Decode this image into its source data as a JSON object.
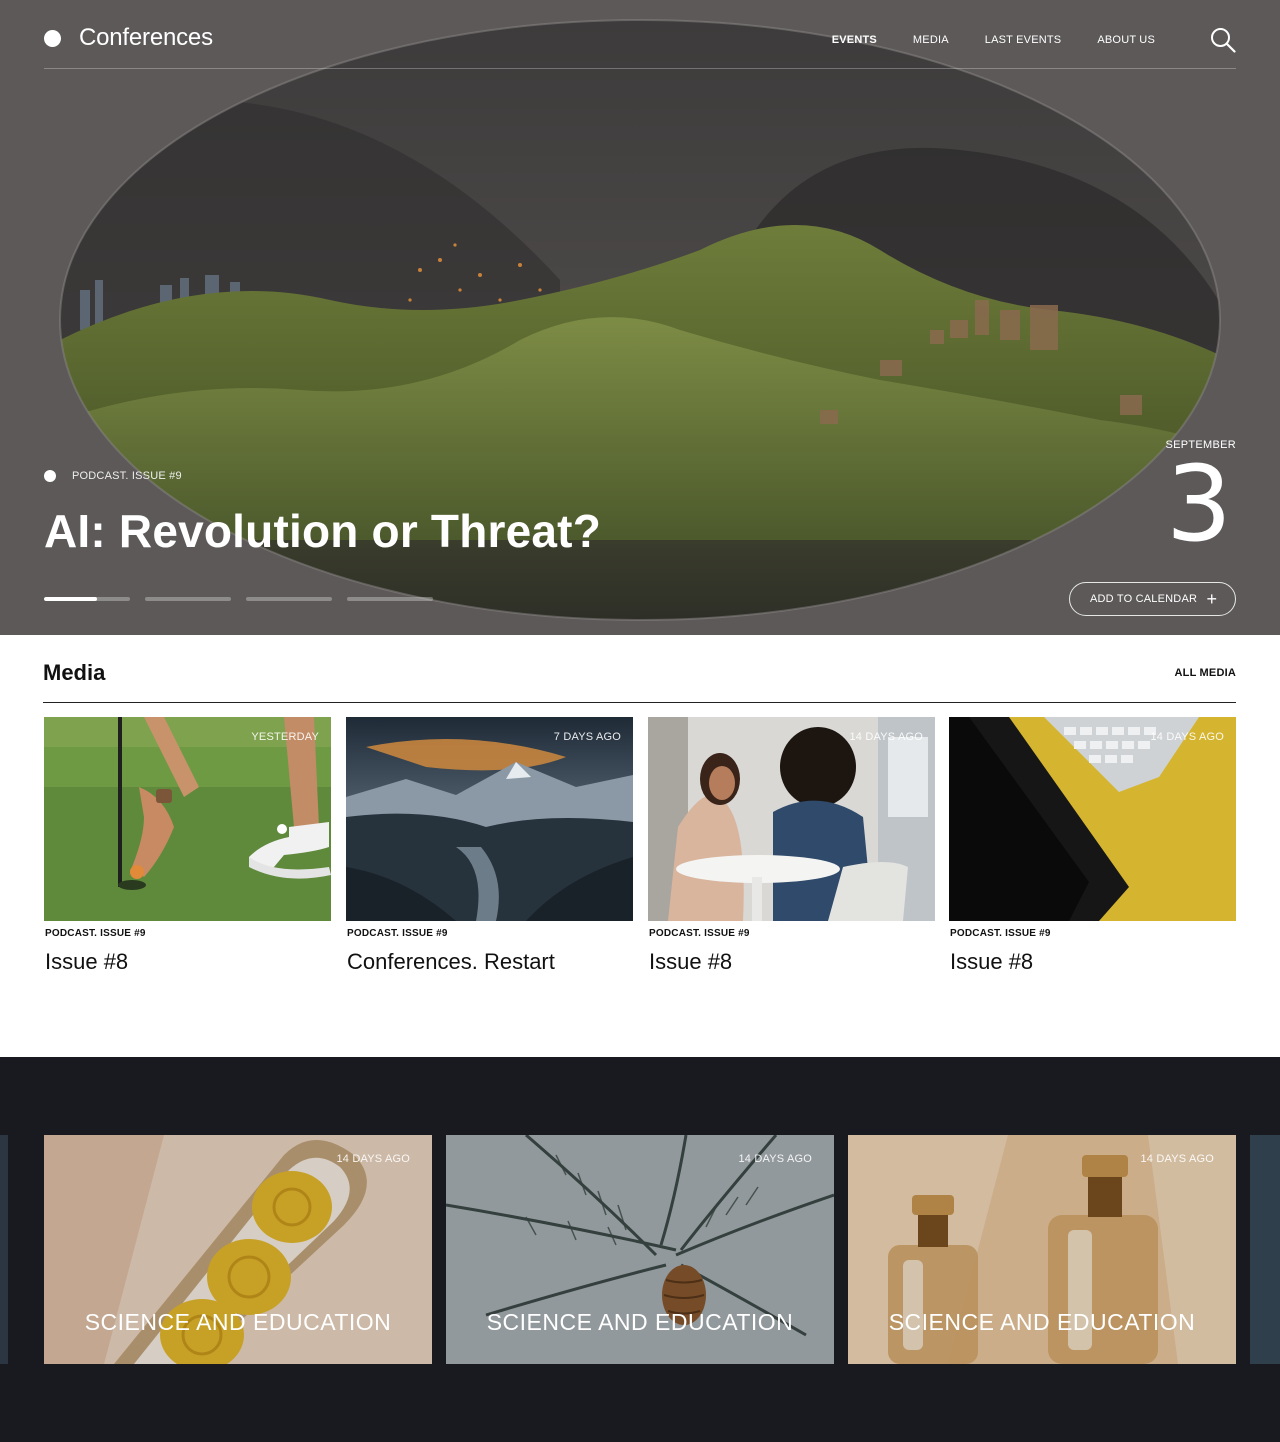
{
  "nav": {
    "logo_text": "Conferences",
    "items": [
      {
        "label": "EVENTS",
        "active": true
      },
      {
        "label": "MEDIA",
        "active": false
      },
      {
        "label": "LAST EVENTS",
        "active": false
      },
      {
        "label": "ABOUT US",
        "active": false
      }
    ],
    "search_icon": "search-icon"
  },
  "hero": {
    "kicker": "PODCAST. ISSUE #9",
    "title": "AI: Revolution or Threat?",
    "month": "SEPTEMBER",
    "day": "3",
    "add_to_calendar": "ADD TO CALENDAR",
    "slides": 4,
    "active_slide": 1,
    "active_slide_progress": 0.62
  },
  "media": {
    "title": "Media",
    "all_label": "ALL MEDIA",
    "cards": [
      {
        "time": "YESTERDAY",
        "category": "PODCAST. ISSUE #9",
        "title": "Issue #8"
      },
      {
        "time": "7 DAYS AGO",
        "category": "PODCAST. ISSUE #9",
        "title": "Conferences. Restart"
      },
      {
        "time": "14 DAYS AGO",
        "category": "PODCAST. ISSUE #9",
        "title": "Issue #8"
      },
      {
        "time": "14 DAYS AGO",
        "category": "PODCAST. ISSUE #9",
        "title": "Issue #8"
      }
    ]
  },
  "topics": {
    "tiles": [
      {
        "time": "14 DAYS AGO",
        "label": "SCIENCE AND EDUCATION"
      },
      {
        "time": "14 DAYS AGO",
        "label": "SCIENCE AND EDUCATION"
      },
      {
        "time": "14 DAYS AGO",
        "label": "SCIENCE AND EDUCATION"
      }
    ]
  },
  "colors": {
    "hero_bg": "#5d5959",
    "dark_bg": "#181a1f",
    "text": "#111111",
    "white": "#ffffff"
  }
}
